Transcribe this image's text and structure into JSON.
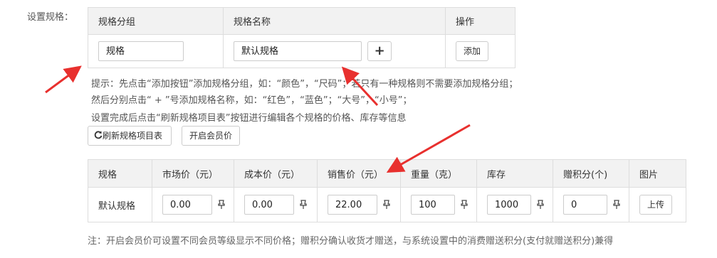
{
  "form": {
    "label": "设置规格："
  },
  "spec_table": {
    "headers": [
      "规格分组",
      "规格名称",
      "操作"
    ],
    "group_value": "规格",
    "name_value": "默认规格",
    "plus_symbol": "+",
    "add_button": "添加"
  },
  "hints": [
    "提示：先点击“添加按钮”添加规格分组，如：“颜色”，“尺码”；若只有一种规格则不需要添加规格分组；",
    "然后分别点击“ + ”号添加规格名称，如：“红色”，“蓝色”；“大号”，“小号”；",
    "设置完成后点击“刷新规格项目表”按钮进行编辑各个规格的价格、库存等信息"
  ],
  "buttons": {
    "refresh": "刷新规格项目表",
    "member_price": "开启会员价"
  },
  "price_table": {
    "headers": [
      "规格",
      "市场价（元）",
      "成本价（元）",
      "销售价（元）",
      "重量（克）",
      "库存",
      "赠积分(个)",
      "图片"
    ],
    "row": {
      "spec": "默认规格",
      "market_price": "0.00",
      "cost_price": "0.00",
      "sale_price": "22.00",
      "weight": "100",
      "stock": "1000",
      "points": "0",
      "upload": "上传"
    }
  },
  "note": "注：开启会员价可设置不同会员等级显示不同价格；赠积分确认收货才赠送，与系统设置中的消费赠送积分(支付就赠送积分)兼得",
  "colors": {
    "arrow": "#e8302e",
    "header_bg": "#f2f2f2",
    "border": "#dddddd"
  }
}
